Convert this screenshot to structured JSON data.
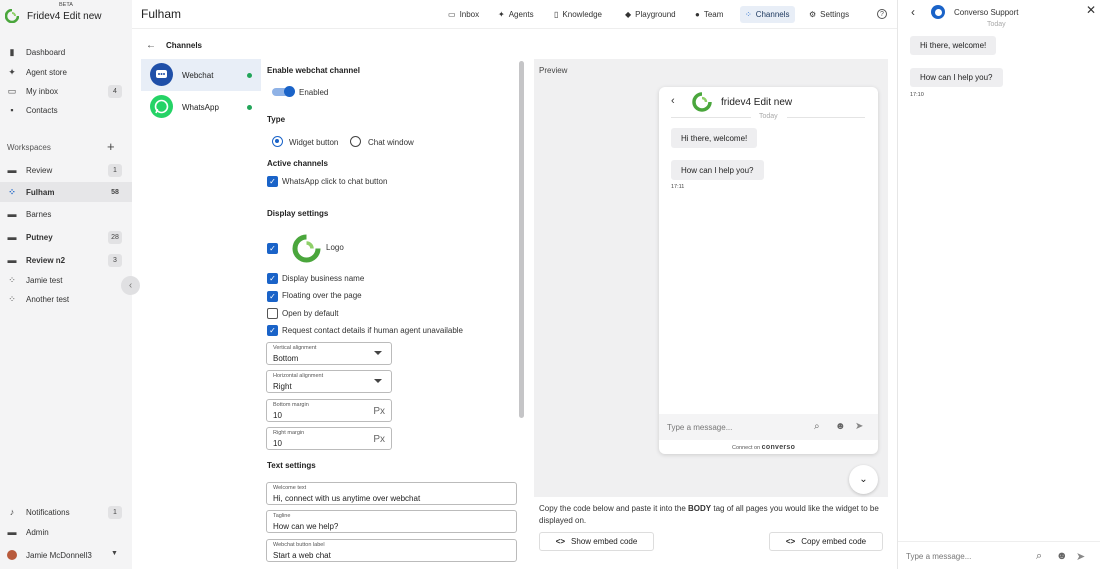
{
  "app": {
    "brand": "Fridev4 Edit new",
    "beta": "BETA"
  },
  "sidebar": {
    "nav": [
      {
        "label": "Dashboard",
        "icon": "bar-chart-icon"
      },
      {
        "label": "Agent store",
        "icon": "sparkle-icon"
      },
      {
        "label": "My inbox",
        "icon": "inbox-icon",
        "count": "4"
      },
      {
        "label": "Contacts",
        "icon": "contacts-icon"
      }
    ],
    "workspaces_label": "Workspaces",
    "workspaces": [
      {
        "label": "Review",
        "count": "1"
      },
      {
        "label": "Fulham",
        "count": "58",
        "active": true
      },
      {
        "label": "Barnes"
      },
      {
        "label": "Putney",
        "count": "28"
      },
      {
        "label": "Review n2",
        "count": "3"
      },
      {
        "label": "Jamie test"
      },
      {
        "label": "Another test"
      }
    ],
    "bottom": [
      {
        "label": "Notifications",
        "count": "1"
      },
      {
        "label": "Admin"
      },
      {
        "label": "Jamie McDonnell3"
      }
    ]
  },
  "header": {
    "title": "Fulham",
    "tabs": [
      {
        "label": "Inbox",
        "icon": "inbox-icon"
      },
      {
        "label": "Agents",
        "icon": "sparkle-icon"
      },
      {
        "label": "Knowledge",
        "icon": "book-icon"
      },
      {
        "label": "Playground",
        "icon": "gamepad-icon"
      },
      {
        "label": "Team",
        "icon": "team-icon"
      },
      {
        "label": "Channels",
        "icon": "channels-icon",
        "active": true
      },
      {
        "label": "Settings",
        "icon": "gear-icon"
      }
    ],
    "help": "?"
  },
  "channels": {
    "title": "Channels",
    "items": [
      {
        "label": "Webchat",
        "status": "active"
      },
      {
        "label": "WhatsApp",
        "status": "active"
      }
    ]
  },
  "form": {
    "enable_heading": "Enable webchat channel",
    "enabled_label": "Enabled",
    "type_heading": "Type",
    "type_options": [
      "Widget button",
      "Chat window"
    ],
    "type_selected": "Widget button",
    "active_heading": "Active channels",
    "active_whatsapp": "WhatsApp click to chat button",
    "display_heading": "Display settings",
    "logo_label": "Logo",
    "display_name": "Display business name",
    "floating": "Floating over the page",
    "open_default": "Open by default",
    "request_contact": "Request contact details if human agent unavailable",
    "vertical": {
      "label": "Vertical alignment",
      "value": "Bottom"
    },
    "horizontal": {
      "label": "Horizontal alignment",
      "value": "Right"
    },
    "bottom_margin": {
      "label": "Bottom margin",
      "value": "10",
      "unit": "Px"
    },
    "right_margin": {
      "label": "Right margin",
      "value": "10",
      "unit": "Px"
    },
    "text_heading": "Text settings",
    "welcome": {
      "label": "Welcome text",
      "value": "Hi, connect with us anytime over webchat"
    },
    "tagline": {
      "label": "Tagline",
      "value": "How can we help?"
    },
    "button_label": {
      "label": "Webchat button label",
      "value": "Start a web chat"
    }
  },
  "preview": {
    "label": "Preview",
    "widget_title": "fridev4 Edit new",
    "day": "Today",
    "messages": [
      "Hi there, welcome!",
      "How can I help you?"
    ],
    "time": "17:11",
    "input_placeholder": "Type a message...",
    "powered": "Connect on",
    "powered_brand": "converso",
    "instructions_pre": "Copy the code below and paste it into the ",
    "instructions_bold": "BODY",
    "instructions_post": " tag of all pages you would like the widget to be displayed on.",
    "show_btn": "Show embed code",
    "copy_btn": "Copy embed code"
  },
  "right_panel": {
    "title": "Converso Support",
    "day": "Today",
    "messages": [
      "Hi there, welcome!",
      "How can I help you?"
    ],
    "time": "17:10",
    "input_placeholder": "Type a message..."
  },
  "colors": {
    "accent": "#1a63c8",
    "green": "#22a559",
    "sidebar_bg": "#f4f4f5"
  }
}
